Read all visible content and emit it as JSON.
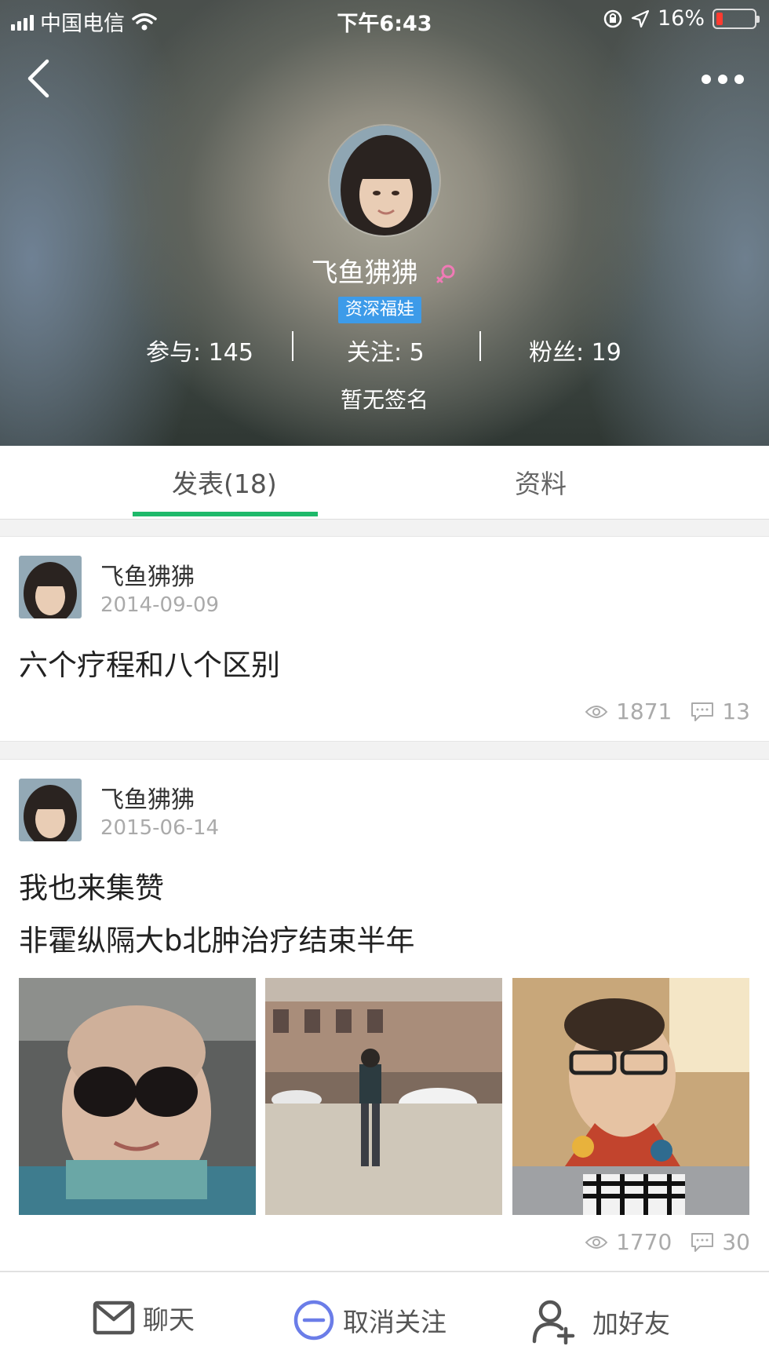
{
  "status_bar": {
    "carrier": "中国电信",
    "time": "下午6:43",
    "battery_percent": "16%",
    "battery_level": 0.16,
    "battery_color": "#ff3b30"
  },
  "header": {
    "back_icon": "chevron-left-icon",
    "more_icon": "more-dots-icon",
    "name": "飞鱼狒狒",
    "gender_icon": "female-icon",
    "badge": "资深福娃",
    "badge_color": "#3d9be9",
    "stats": {
      "participate": "参与: 145",
      "follow": "关注: 5",
      "fans": "粉丝: 19"
    },
    "signature": "暂无签名"
  },
  "tabs": {
    "posts": "发表(18)",
    "profile": "资料",
    "accent_color": "#1eb96a"
  },
  "posts": [
    {
      "author": "飞鱼狒狒",
      "date": "2014-09-09",
      "lines": [
        "六个疗程和八个区别"
      ],
      "views": "1871",
      "comments": "13"
    },
    {
      "author": "飞鱼狒狒",
      "date": "2015-06-14",
      "lines": [
        "我也来集赞",
        "非霍纵隔大b北肿治疗结束半年"
      ],
      "views": "1770",
      "comments": "30"
    }
  ],
  "bottom_bar": {
    "chat": "聊天",
    "unfollow": "取消关注",
    "add_friend": "加好友"
  }
}
